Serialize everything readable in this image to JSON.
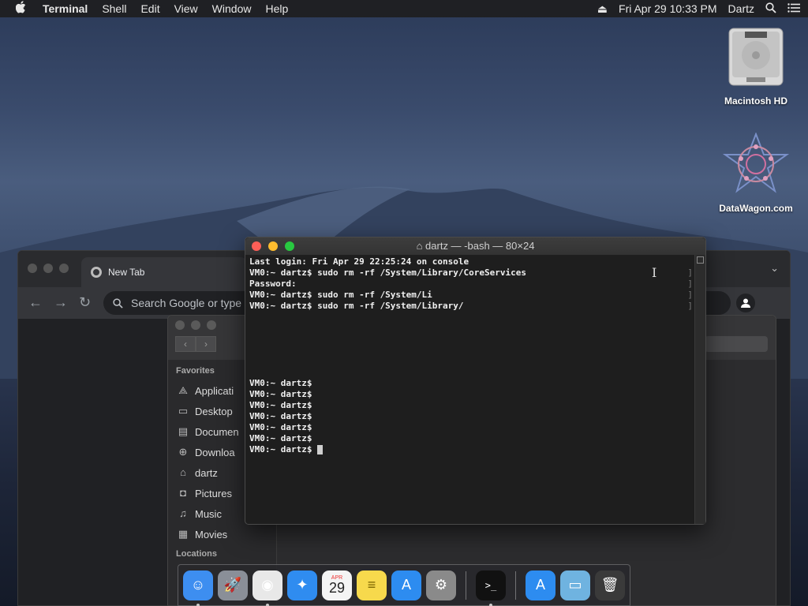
{
  "menubar": {
    "items": [
      {
        "label": "Terminal",
        "bold": true
      },
      {
        "label": "Shell"
      },
      {
        "label": "Edit"
      },
      {
        "label": "View"
      },
      {
        "label": "Window"
      },
      {
        "label": "Help"
      }
    ],
    "datetime": "Fri Apr 29  10:33 PM",
    "user": "Dartz"
  },
  "desktop": {
    "icons": [
      {
        "label": "Macintosh HD",
        "icon": "hard-drive-icon"
      },
      {
        "label": "DataWagon.com",
        "icon": "mandala-icon"
      }
    ]
  },
  "chrome": {
    "tab_title": "New Tab",
    "omnibox_placeholder": "Search Google or type"
  },
  "finder": {
    "favorites_header": "Favorites",
    "favorites": [
      {
        "label": "Applicati",
        "icon": "applications-icon"
      },
      {
        "label": "Desktop",
        "icon": "desktop-icon"
      },
      {
        "label": "Documen",
        "icon": "documents-icon"
      },
      {
        "label": "Downloa",
        "icon": "downloads-icon"
      },
      {
        "label": "dartz",
        "icon": "home-icon"
      },
      {
        "label": "Pictures",
        "icon": "pictures-icon"
      },
      {
        "label": "Music",
        "icon": "music-icon"
      },
      {
        "label": "Movies",
        "icon": "movies-icon"
      }
    ],
    "locations_header": "Locations"
  },
  "terminal": {
    "title": "dartz — -bash — 80×24",
    "lines": [
      "Last login: Fri Apr 29 22:25:24 on console",
      "VM0:~ dartz$ sudo rm -rf /System/Library/CoreServices",
      "Password:",
      "VM0:~ dartz$ sudo rm -rf /System/Li",
      "VM0:~ dartz$ sudo rm -rf /System/Library/",
      "",
      "",
      "",
      "",
      "",
      "",
      "VM0:~ dartz$",
      "VM0:~ dartz$",
      "VM0:~ dartz$",
      "VM0:~ dartz$",
      "VM0:~ dartz$",
      "VM0:~ dartz$",
      "VM0:~ dartz$ "
    ]
  },
  "dock": {
    "apps": [
      {
        "name": "finder",
        "icon": "finder-icon",
        "color": "#3d8ef0",
        "running": true
      },
      {
        "name": "launchpad",
        "icon": "rocket-icon",
        "color": "#8a8f98",
        "running": false
      },
      {
        "name": "chrome",
        "icon": "chrome-icon",
        "color": "#e8e8e8",
        "running": true
      },
      {
        "name": "safari",
        "icon": "compass-icon",
        "color": "#2f8cf0",
        "running": false
      },
      {
        "name": "calendar",
        "icon": "calendar-icon",
        "color": "#f4f4f4",
        "running": false,
        "month": "APR",
        "day": "29"
      },
      {
        "name": "notes",
        "icon": "notes-icon",
        "color": "#f7d94c",
        "running": false
      },
      {
        "name": "app-store",
        "icon": "app-store-icon",
        "color": "#2d8cf0",
        "running": false
      },
      {
        "name": "system-preferences",
        "icon": "gear-icon",
        "color": "#8a8a8a",
        "running": false
      },
      {
        "name": "terminal",
        "icon": "terminal-icon",
        "color": "#111111",
        "running": true
      },
      {
        "name": "applications-stack",
        "icon": "app-store-icon",
        "color": "#2d8cf0",
        "running": false
      },
      {
        "name": "downloads-folder",
        "icon": "folder-icon",
        "color": "#6fb3e0",
        "running": false
      },
      {
        "name": "trash",
        "icon": "trash-icon",
        "color": "#3a3a3a",
        "running": false
      }
    ]
  }
}
